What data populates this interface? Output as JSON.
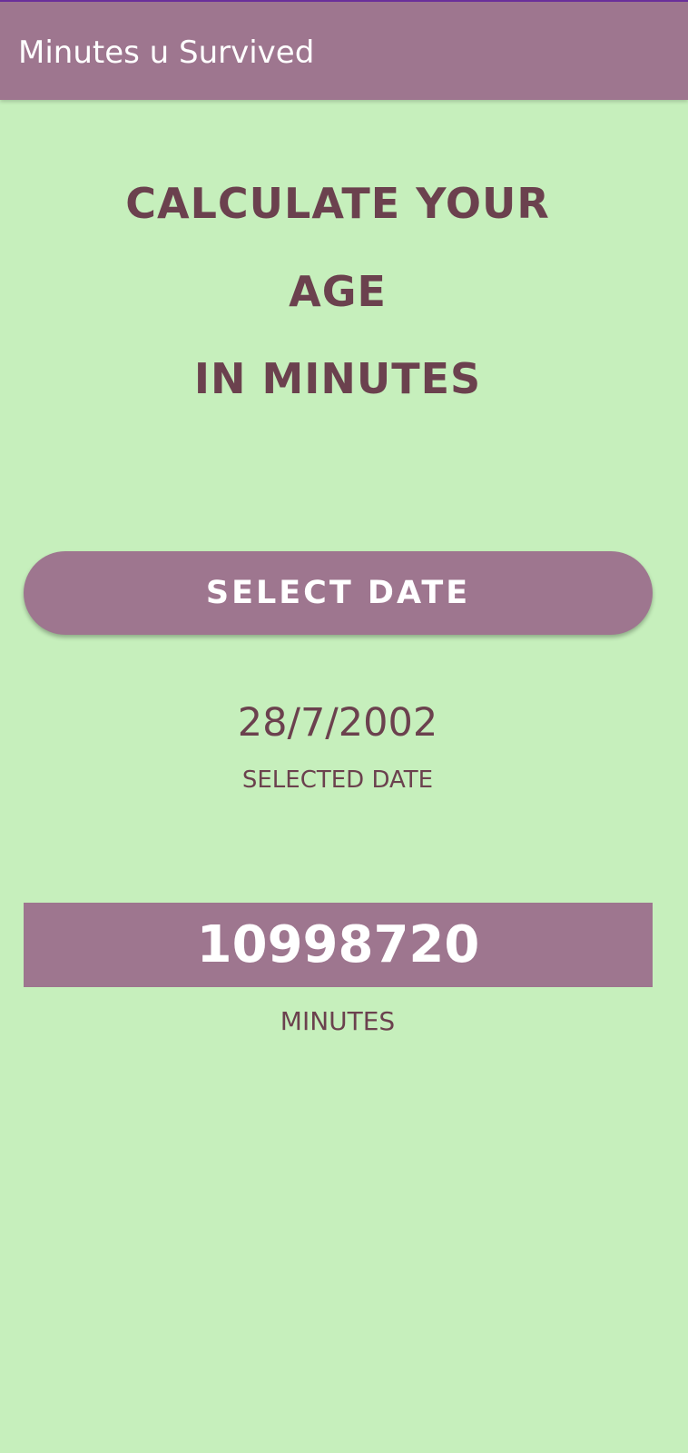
{
  "app_bar": {
    "title": "Minutes u Survived",
    "background_color": "#9e768f"
  },
  "headline": {
    "line1": "CALCULATE YOUR",
    "line2": "AGE",
    "line3": "IN MINUTES"
  },
  "select_date_button": {
    "label": "SELECT DATE"
  },
  "selected_date": {
    "value": "28/7/2002",
    "caption": "SELECTED DATE"
  },
  "result": {
    "value": "10998720",
    "caption": "MINUTES"
  },
  "colors": {
    "background": "#c6efbc",
    "accent": "#9e768f",
    "text": "#6b414e"
  }
}
